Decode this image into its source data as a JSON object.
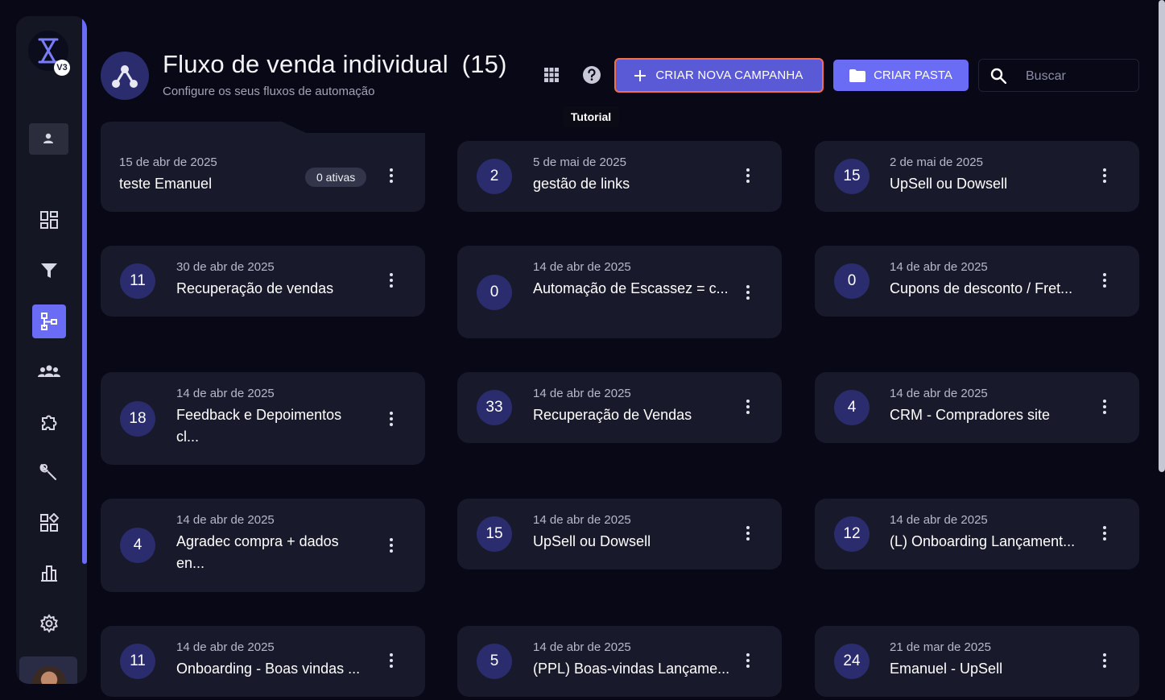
{
  "sidebar": {
    "logo_badge": "V3",
    "nav": [
      "dashboard",
      "funnels",
      "flows",
      "contacts",
      "integrations",
      "tools",
      "apps",
      "reports",
      "settings"
    ]
  },
  "header": {
    "title": "Fluxo de venda individual",
    "count": "(15)",
    "subtitle": "Configure os seus fluxos de automação",
    "tooltip": "Tutorial",
    "create_campaign_label": "CRIAR NOVA CAMPANHA",
    "create_folder_label": "CRIAR PASTA",
    "search_placeholder": "Buscar"
  },
  "colors": {
    "accent": "#6b6cf6",
    "card": "#181a2b",
    "background": "#080817",
    "highlight_border": "#f26f4a"
  },
  "flows": [
    {
      "date": "15 de abr de 2025",
      "name": "teste Emanuel",
      "badge": "0 ativas"
    },
    {
      "count": "2",
      "date": "5 de mai de 2025",
      "name": "gestão de links"
    },
    {
      "count": "15",
      "date": "2 de mai de 2025",
      "name": "UpSell ou Dowsell"
    },
    {
      "count": "11",
      "date": "30 de abr de 2025",
      "name": "Recuperação de vendas"
    },
    {
      "count": "0",
      "date": "14 de abr de 2025",
      "name": "Automação de Escassez = c..."
    },
    {
      "count": "0",
      "date": "14 de abr de 2025",
      "name": "Cupons de desconto / Fret..."
    },
    {
      "count": "18",
      "date": "14 de abr de 2025",
      "name": "Feedback e Depoimentos cl..."
    },
    {
      "count": "33",
      "date": "14 de abr de 2025",
      "name": "Recuperação de Vendas"
    },
    {
      "count": "4",
      "date": "14 de abr de 2025",
      "name": "CRM - Compradores site"
    },
    {
      "count": "4",
      "date": "14 de abr de 2025",
      "name": "Agradec compra + dados en..."
    },
    {
      "count": "15",
      "date": "14 de abr de 2025",
      "name": "UpSell ou Dowsell"
    },
    {
      "count": "12",
      "date": "14 de abr de 2025",
      "name": "(L) Onboarding Lançament..."
    },
    {
      "count": "11",
      "date": "14 de abr de 2025",
      "name": "Onboarding - Boas vindas ..."
    },
    {
      "count": "5",
      "date": "14 de abr de 2025",
      "name": "(PPL) Boas-vindas Lançame..."
    },
    {
      "count": "24",
      "date": "21 de mar de 2025",
      "name": "Emanuel - UpSell"
    }
  ]
}
